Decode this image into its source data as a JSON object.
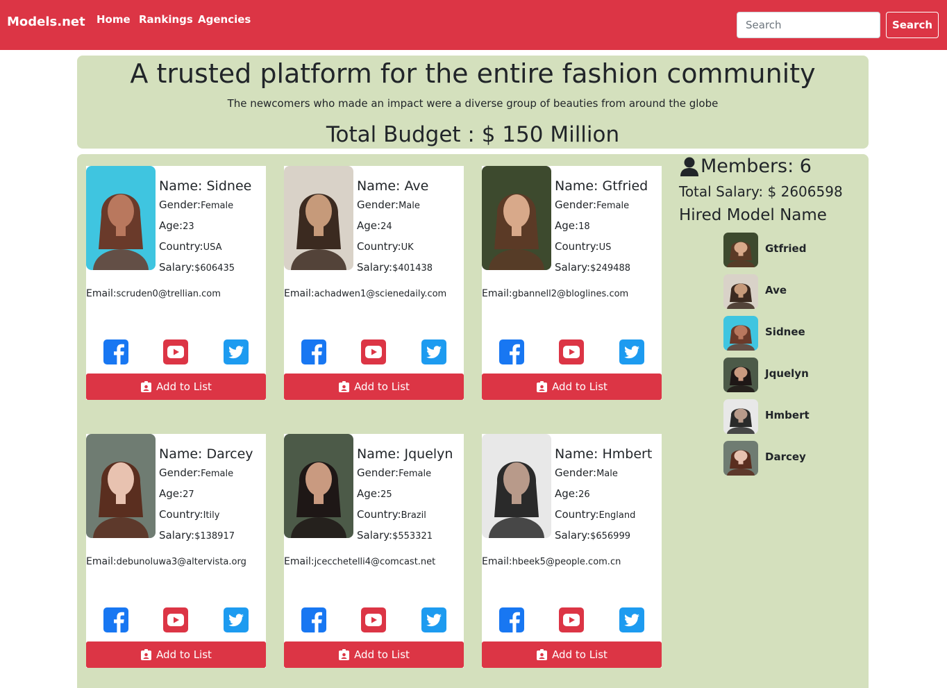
{
  "navbar": {
    "brand": "Models.net",
    "links": [
      "Home",
      "Rankings",
      "Agencies"
    ],
    "search_placeholder": "Search",
    "search_button": "Search"
  },
  "hero": {
    "title": "A trusted platform for the entire fashion community",
    "subtitle": "The newcomers who made an impact were a diverse group of beauties from around the globe",
    "budget": "Total Budget : $ 150 Million"
  },
  "labels": {
    "name": "Name: ",
    "gender": "Gender:",
    "age": "Age:",
    "country": "Country:",
    "salary": "Salary:",
    "email": "Email:",
    "add_button": "Add to List"
  },
  "models": [
    {
      "name": "Sidnee",
      "gender": "Female",
      "age": "23",
      "country": "USA",
      "salary": "$606435",
      "email": "scruden0@trellian.com"
    },
    {
      "name": "Ave",
      "gender": "Male",
      "age": "24",
      "country": "UK",
      "salary": "$401438",
      "email": "achadwen1@scienedaily.com"
    },
    {
      "name": "Gtfried",
      "gender": "Female",
      "age": "18",
      "country": "US",
      "salary": "$249488",
      "email": "gbannell2@bloglines.com"
    },
    {
      "name": "Darcey",
      "gender": "Female",
      "age": "27",
      "country": "Itily",
      "salary": "$138917",
      "email": "debunoluwa3@altervista.org"
    },
    {
      "name": "Jquelyn",
      "gender": "Female",
      "age": "25",
      "country": "Brazil",
      "salary": "$553321",
      "email": "jcecchetelli4@comcast.net"
    },
    {
      "name": "Hmbert",
      "gender": "Male",
      "age": "26",
      "country": "England",
      "salary": "$656999",
      "email": "hbeek5@people.com.cn"
    }
  ],
  "sidebar": {
    "members": "Members: 6",
    "total_salary": "Total Salary: $ 2606598",
    "hired_heading": "Hired Model Name",
    "hired": [
      "Gtfried",
      "Ave",
      "Sidnee",
      "Jquelyn",
      "Hmbert",
      "Darcey"
    ]
  },
  "colors": {
    "brand_red": "#dc3545",
    "panel_green": "#d4e0bd",
    "facebook_blue": "#1877f2",
    "twitter_blue": "#1d9bf0"
  }
}
